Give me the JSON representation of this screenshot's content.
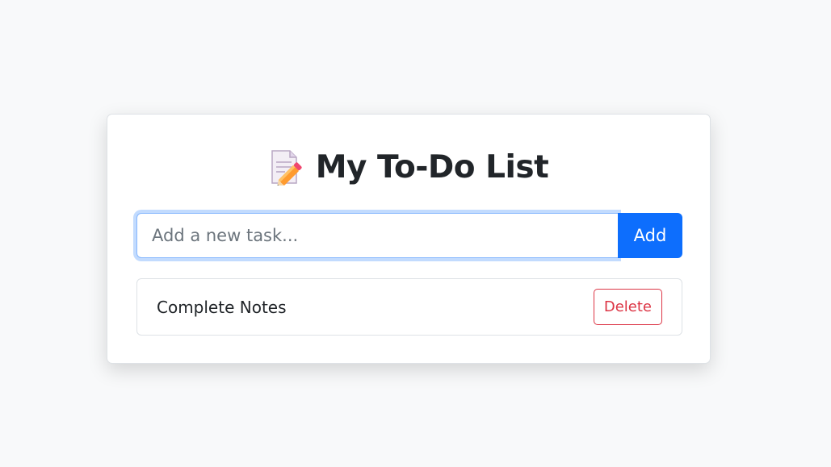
{
  "header": {
    "title": "My To-Do List",
    "icon": "memo-icon"
  },
  "new_task": {
    "value": "",
    "placeholder": "Add a new task...",
    "add_label": "Add"
  },
  "tasks": [
    {
      "text": "Complete Notes",
      "delete_label": "Delete"
    }
  ],
  "colors": {
    "primary": "#0d6efd",
    "danger": "#dc3545",
    "background": "#f8f9fa"
  }
}
